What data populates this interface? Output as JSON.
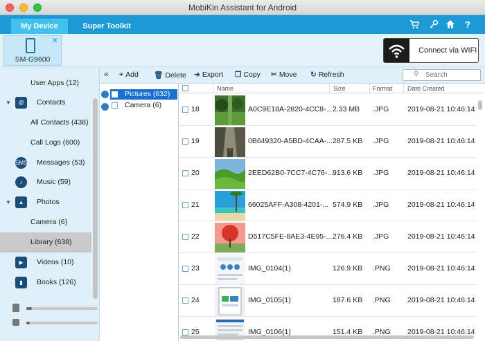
{
  "window": {
    "title": "MobiKin Assistant for Android"
  },
  "nav": {
    "tabs": [
      "My Device",
      "Super Toolkit"
    ],
    "icons": [
      "cart-icon",
      "key-icon",
      "home-icon",
      "help-icon"
    ]
  },
  "device": {
    "name": "SM-G9600"
  },
  "wifi": {
    "label": "Connect via WIFI"
  },
  "sidebar": {
    "items": [
      {
        "label": "User Apps (12)",
        "icon": "",
        "level": 2
      },
      {
        "label": "Contacts",
        "icon": "contacts-icon",
        "level": 1,
        "expanded": true
      },
      {
        "label": "All Contacts (438)",
        "icon": "",
        "level": 2
      },
      {
        "label": "Call Logs (600)",
        "icon": "",
        "level": 2
      },
      {
        "label": "Messages (53)",
        "icon": "sms-icon",
        "level": 1
      },
      {
        "label": "Music (59)",
        "icon": "music-icon",
        "level": 1
      },
      {
        "label": "Photos",
        "icon": "photos-icon",
        "level": 1,
        "expanded": true
      },
      {
        "label": "Camera (6)",
        "icon": "",
        "level": 2
      },
      {
        "label": "Library (638)",
        "icon": "",
        "level": 2,
        "selected": true
      },
      {
        "label": "Videos (10)",
        "icon": "videos-icon",
        "level": 1
      },
      {
        "label": "Books (126)",
        "icon": "books-icon",
        "level": 1
      }
    ],
    "storage": [
      {
        "icon": "phone-storage-icon",
        "used": 0.08
      },
      {
        "icon": "sd-card-icon",
        "used": 0.05
      }
    ]
  },
  "toolbar": {
    "buttons": [
      "Add",
      "Delete",
      "Export",
      "Copy",
      "Move",
      "Refresh"
    ],
    "search_placeholder": "Search"
  },
  "folders": [
    {
      "label": "Pictures (632)",
      "selected": true
    },
    {
      "label": "Camera (6)",
      "selected": false
    }
  ],
  "table": {
    "columns": [
      "Name",
      "Size",
      "Format",
      "Date Created"
    ],
    "rows": [
      {
        "num": "18",
        "name": "A0C9E18A-2820-4CC8-...",
        "size": "2.33 MB",
        "format": ".JPG",
        "date": "2019-08-21  10:46:14",
        "thumb": "green-park"
      },
      {
        "num": "19",
        "name": "0B649320-A5BD-4CAA-...",
        "size": "287.5 KB",
        "format": ".JPG",
        "date": "2019-08-21  10:46:14",
        "thumb": "canyon"
      },
      {
        "num": "20",
        "name": "2EED62B0-7CC7-4C76-...",
        "size": "913.6 KB",
        "format": ".JPG",
        "date": "2019-08-21  10:46:14",
        "thumb": "green-hills"
      },
      {
        "num": "21",
        "name": "66025AFF-A308-4201-...",
        "size": "574.9 KB",
        "format": ".JPG",
        "date": "2019-08-21  10:46:14",
        "thumb": "beach"
      },
      {
        "num": "22",
        "name": "D517C5FE-8AE3-4E95-...",
        "size": "276.4 KB",
        "format": ".JPG",
        "date": "2019-08-21  10:46:14",
        "thumb": "red-tree"
      },
      {
        "num": "23",
        "name": "IMG_0104(1)",
        "size": "126.9 KB",
        "format": ".PNG",
        "date": "2019-08-21  10:46:14",
        "thumb": "screenshot-1"
      },
      {
        "num": "24",
        "name": "IMG_0105(1)",
        "size": "187.6 KB",
        "format": ".PNG",
        "date": "2019-08-21  10:46:14",
        "thumb": "screenshot-2"
      },
      {
        "num": "25",
        "name": "IMG_0106(1)",
        "size": "151.4 KB",
        "format": ".PNG",
        "date": "2019-08-21  10:46:14",
        "thumb": "screenshot-3"
      }
    ]
  },
  "colors": {
    "accent": "#1c9ad6",
    "selection": "#1770d2",
    "sidebar_bg": "#dff0f8"
  }
}
